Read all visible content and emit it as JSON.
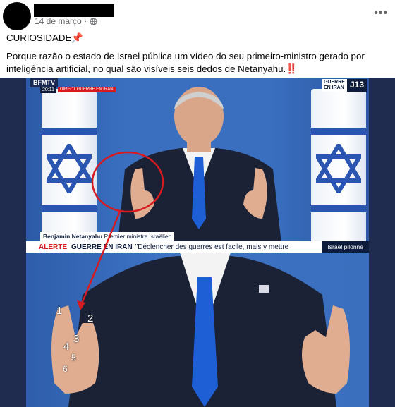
{
  "post": {
    "date": "14 de março",
    "separator": "·",
    "privacy_icon": "globe-icon",
    "more_icon": "more-options-icon",
    "more_label": "•••",
    "text_line1": "CURIOSIDADE📌",
    "text_line2": "Porque razão o estado de Israel pública um vídeo do seu primeiro-ministro gerado por inteligência artificial, no qual são visíveis seis dedos de Netanyahu.‼️"
  },
  "broadcast": {
    "channel": "BFMTV",
    "time": "20:11",
    "direct_tag": "DIRECT GUERRE EN IRAN",
    "corner_tag_top": "GUERRE EN IRAN",
    "corner_tag_day": "J13",
    "lower_third_name": "Benjamin Netanyahu",
    "lower_third_role": "Premier ministre israëlien",
    "alert_label": "ALERTE",
    "alert_topic": "GUERRE EN IRAN",
    "alert_quote": "\"Déclencher des guerres est facile, mais y mettre",
    "side_tag": "Israël pilonne"
  },
  "finger_labels": [
    "1",
    "2",
    "3",
    "4",
    "5",
    "6"
  ],
  "colors": {
    "accent": "#d71920",
    "flag_blue": "#2a55b0",
    "studio_blue": "#3a6fc0"
  }
}
